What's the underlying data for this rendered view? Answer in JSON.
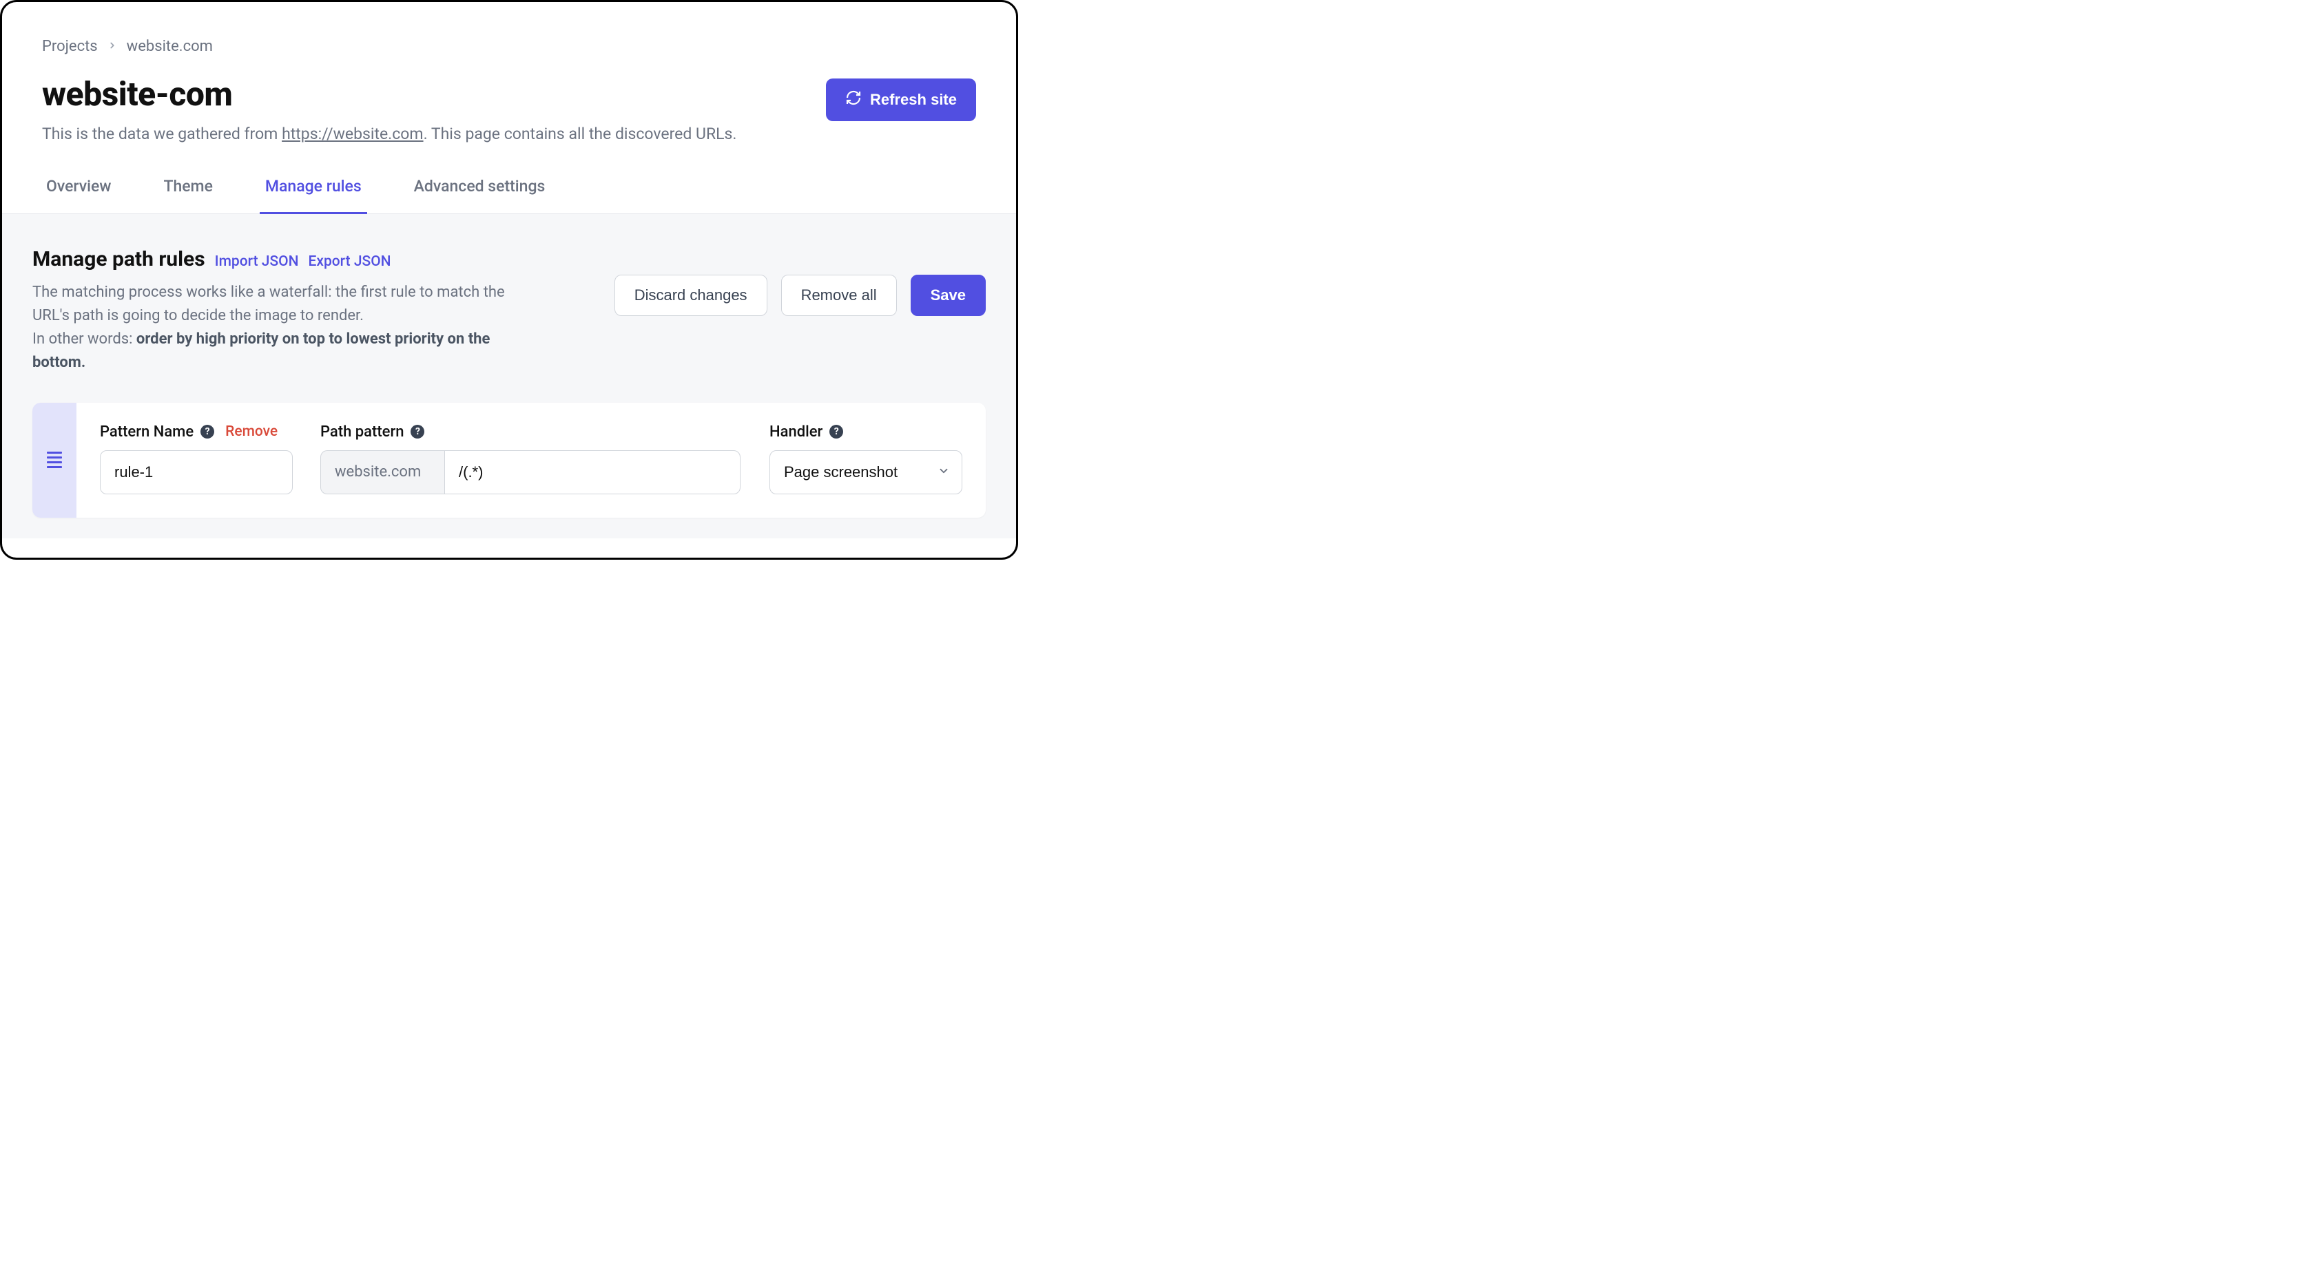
{
  "breadcrumb": {
    "root": "Projects",
    "current": "website.com"
  },
  "header": {
    "title": "website-com",
    "subtitle_prefix": "This is the data we gathered from ",
    "subtitle_link": "https://website.com",
    "subtitle_suffix": ". This page contains all the discovered URLs.",
    "refresh_label": "Refresh site"
  },
  "tabs": [
    {
      "label": "Overview",
      "active": false
    },
    {
      "label": "Theme",
      "active": false
    },
    {
      "label": "Manage rules",
      "active": true
    },
    {
      "label": "Advanced settings",
      "active": false
    }
  ],
  "panel": {
    "title": "Manage path rules",
    "import_label": "Import JSON",
    "export_label": "Export JSON",
    "desc_line1": "The matching process works like a waterfall: the first rule to match the URL's path is going to decide the image to render.",
    "desc_line2_prefix": "In other words: ",
    "desc_line2_bold": "order by high priority on top to lowest priority on the bottom.",
    "discard_label": "Discard changes",
    "remove_all_label": "Remove all",
    "save_label": "Save"
  },
  "rule": {
    "pattern_name_label": "Pattern Name",
    "remove_label": "Remove",
    "path_pattern_label": "Path pattern",
    "handler_label": "Handler",
    "name_value": "rule-1",
    "domain_prefix": "website.com",
    "path_value": "/(.*)",
    "handler_value": "Page screenshot"
  }
}
